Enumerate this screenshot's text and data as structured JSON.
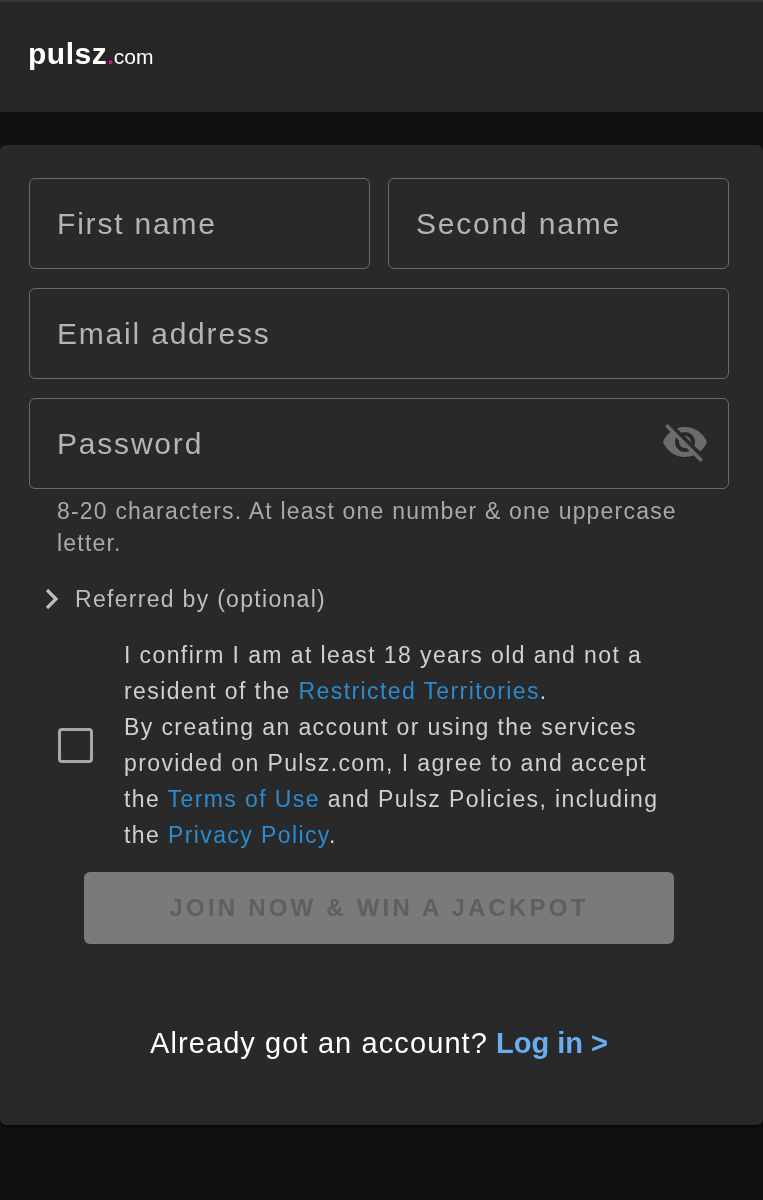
{
  "header": {
    "logo": {
      "name": "pulsz",
      "dot": ".",
      "domain": "com"
    }
  },
  "first_name": {
    "placeholder": "First name"
  },
  "second_name": {
    "placeholder": "Second name"
  },
  "email": {
    "placeholder": "Email address"
  },
  "password": {
    "placeholder": "Password",
    "revealed": false,
    "hint": "8-20 characters. At least one number & one uppercase letter."
  },
  "referral": {
    "label": "Referred by (optional)",
    "expanded": false
  },
  "consent": {
    "checked": false,
    "paragraphs": [
      [
        {
          "kind": "text",
          "text": "I confirm I am at least 18 years old and not a resident of the "
        },
        {
          "kind": "link",
          "text": "Restricted Territories"
        },
        {
          "kind": "text",
          "text": "."
        }
      ],
      [
        {
          "kind": "text",
          "text": "By creating an account or using the services provided on Pulsz.com, I agree to and accept the "
        },
        {
          "kind": "link",
          "text": "Terms of Use"
        },
        {
          "kind": "text",
          "text": " and Pulsz Policies, including the "
        },
        {
          "kind": "link",
          "text": "Privacy Policy"
        },
        {
          "kind": "text",
          "text": "."
        }
      ]
    ]
  },
  "join_button": {
    "label": "JOIN NOW & WIN A JACKPOT",
    "disabled": true
  },
  "footer": {
    "prompt": "Already got an account?",
    "link": "Log in >"
  }
}
